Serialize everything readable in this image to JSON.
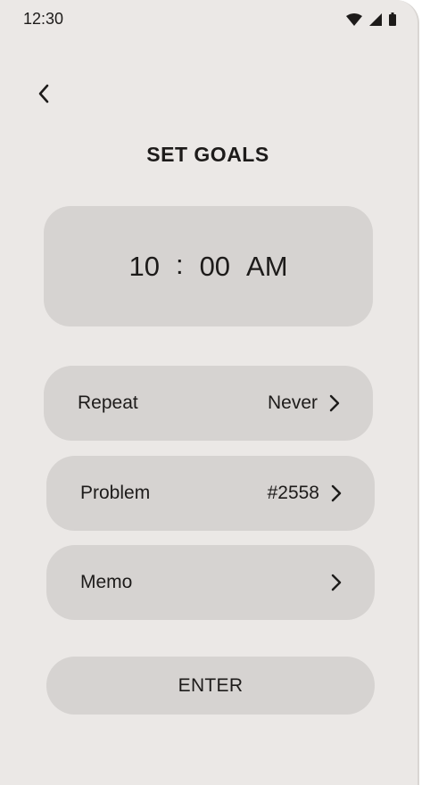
{
  "status_bar": {
    "time": "12:30",
    "icons": [
      "wifi-icon",
      "cellular-signal-icon",
      "battery-icon"
    ]
  },
  "header": {
    "back_icon": "chevron-left-icon",
    "title": "SET GOALS"
  },
  "time_picker": {
    "hour": "10",
    "separator": ":",
    "minute": "00",
    "period": "AM"
  },
  "settings": {
    "repeat": {
      "label": "Repeat",
      "value": "Never",
      "icon": "chevron-right-icon"
    },
    "problem": {
      "label": "Problem",
      "value": "#2558",
      "icon": "chevron-right-icon"
    },
    "memo": {
      "label": "Memo",
      "value": "",
      "icon": "chevron-right-icon"
    }
  },
  "actions": {
    "enter_label": "ENTER"
  },
  "colors": {
    "background": "#ebe8e6",
    "card": "#d6d3d1",
    "text": "#1d1b1a"
  }
}
